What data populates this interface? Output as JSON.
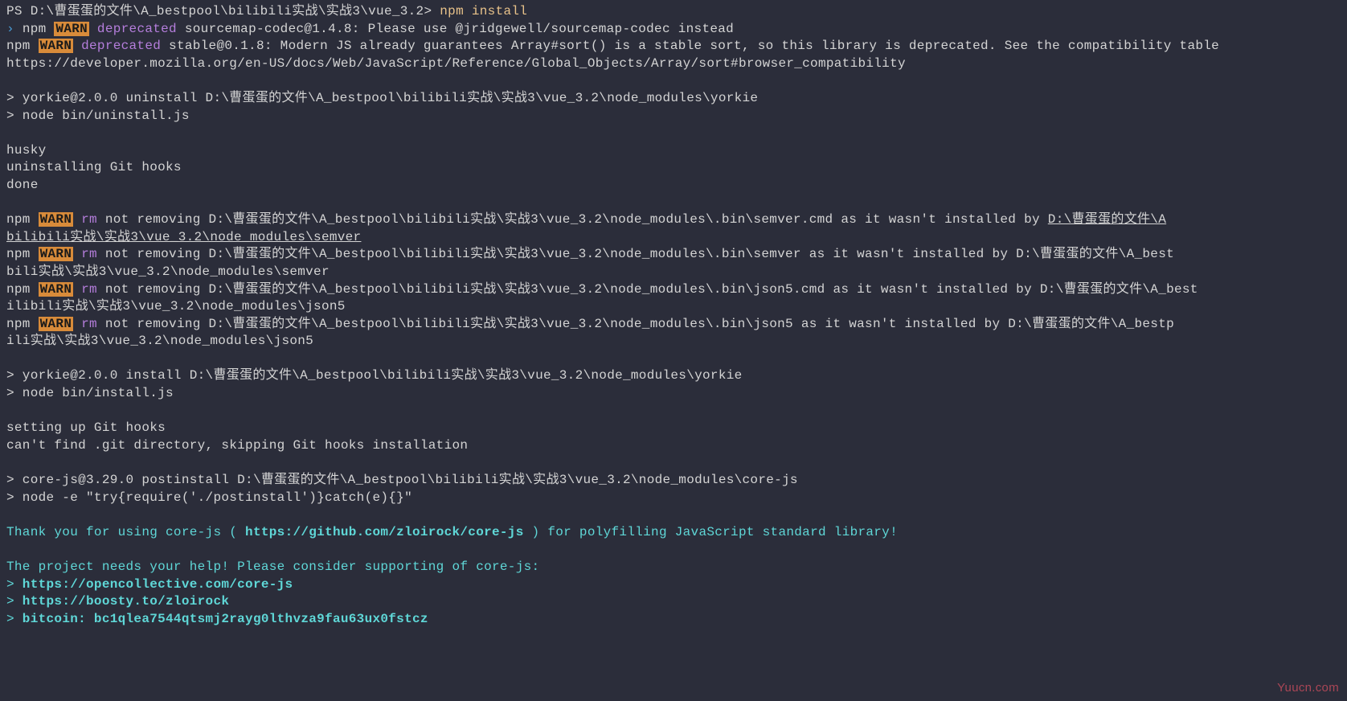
{
  "prompt": {
    "prefix": "PS D:\\曹蛋蛋的文件\\A_bestpool\\bilibili实战\\实战3\\vue_3.2> ",
    "command": "npm install"
  },
  "warnLines": {
    "line1": {
      "npm": "npm ",
      "warn": "WARN",
      "deprecated": " deprecated ",
      "rest": "sourcemap-codec@1.4.8: Please use @jridgewell/sourcemap-codec instead"
    },
    "line2": {
      "npm": "npm ",
      "warn": "WARN",
      "deprecated": " deprecated ",
      "rest": "stable@0.1.8: Modern JS already guarantees Array#sort() is a stable sort, so this library is deprecated. See the compatibility table"
    }
  },
  "mdnUrl": "https://developer.mozilla.org/en-US/docs/Web/JavaScript/Reference/Global_Objects/Array/sort#browser_compatibility",
  "yorkieUninstall": {
    "line1": "> yorkie@2.0.0 uninstall D:\\曹蛋蛋的文件\\A_bestpool\\bilibili实战\\实战3\\vue_3.2\\node_modules\\yorkie",
    "line2": "> node bin/uninstall.js"
  },
  "husky": {
    "line1": "husky",
    "line2": "uninstalling Git hooks",
    "line3": "done"
  },
  "rmWarn1": {
    "npm": "npm ",
    "warn": "WARN",
    "rm": " rm ",
    "rest": "not removing D:\\曹蛋蛋的文件\\A_bestpool\\bilibili实战\\实战3\\vue_3.2\\node_modules\\.bin\\semver.cmd as it wasn't installed by ",
    "underlined1": "D:\\曹蛋蛋的文件\\A",
    "underlined2": "bilibili实战\\实战3\\vue_3.2\\node_modules\\semver"
  },
  "rmWarn2": {
    "npm": "npm ",
    "warn": "WARN",
    "rm": " rm ",
    "rest": "not removing D:\\曹蛋蛋的文件\\A_bestpool\\bilibili实战\\实战3\\vue_3.2\\node_modules\\.bin\\semver as it wasn't installed by D:\\曹蛋蛋的文件\\A_best",
    "line2": "bili实战\\实战3\\vue_3.2\\node_modules\\semver"
  },
  "rmWarn3": {
    "npm": "npm ",
    "warn": "WARN",
    "rm": " rm ",
    "rest": "not removing D:\\曹蛋蛋的文件\\A_bestpool\\bilibili实战\\实战3\\vue_3.2\\node_modules\\.bin\\json5.cmd as it wasn't installed by D:\\曹蛋蛋的文件\\A_best",
    "line2": "ilibili实战\\实战3\\vue_3.2\\node_modules\\json5"
  },
  "rmWarn4": {
    "npm": "npm ",
    "warn": "WARN",
    "rm": " rm ",
    "rest": "not removing D:\\曹蛋蛋的文件\\A_bestpool\\bilibili实战\\实战3\\vue_3.2\\node_modules\\.bin\\json5 as it wasn't installed by D:\\曹蛋蛋的文件\\A_bestp",
    "line2": "ili实战\\实战3\\vue_3.2\\node_modules\\json5"
  },
  "yorkieInstall": {
    "line1": "> yorkie@2.0.0 install D:\\曹蛋蛋的文件\\A_bestpool\\bilibili实战\\实战3\\vue_3.2\\node_modules\\yorkie",
    "line2": "> node bin/install.js"
  },
  "gitHooks": {
    "line1": "setting up Git hooks",
    "line2": "can't find .git directory, skipping Git hooks installation"
  },
  "coreJs": {
    "line1": "> core-js@3.29.0 postinstall D:\\曹蛋蛋的文件\\A_bestpool\\bilibili实战\\实战3\\vue_3.2\\node_modules\\core-js",
    "line2": "> node -e \"try{require('./postinstall')}catch(e){}\""
  },
  "thankYou": {
    "part1": "Thank you for using core-js (",
    "url": " https://github.com/zloirock/core-js ",
    "part2": ") for polyfilling JavaScript standard library!"
  },
  "help": {
    "intro": "The project needs your help! Please consider supporting of core-js:",
    "link1arrow": ">",
    "link1": " https://opencollective.com/core-js ",
    "link2arrow": ">",
    "link2": " https://boosty.to/zloirock ",
    "link3arrow": ">",
    "link3": " bitcoin: bc1qlea7544qtsmj2rayg0lthvza9fau63ux0fstcz "
  },
  "watermark": "Yuucn.com"
}
